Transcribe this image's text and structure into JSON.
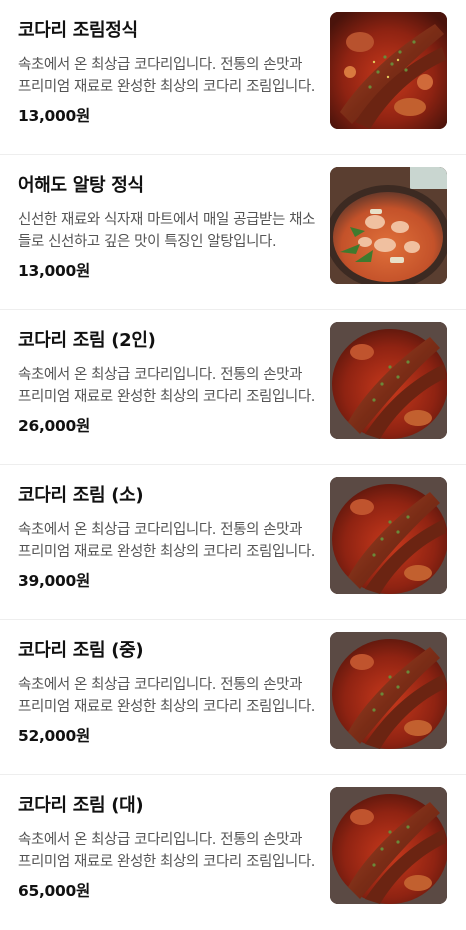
{
  "menu": {
    "items": [
      {
        "name": "코다리 조림정식",
        "description": "속초에서 온 최상급 코다리입니다. 전통의 손맛과 프리미엄 재료로 완성한 최상의 코다리 조림입니다.",
        "price": "13,000원",
        "image": "braised-pollock-photo"
      },
      {
        "name": "어해도 알탕 정식",
        "description": "신선한 재료와 식자재 마트에서 매일 공급받는 채소들로 신선하고 깊은 맛이 특징인 알탕입니다.",
        "price": "13,000원",
        "image": "fish-roe-stew-photo"
      },
      {
        "name": "코다리 조림 (2인)",
        "description": "속초에서 온 최상급 코다리입니다. 전통의 손맛과 프리미엄 재료로 완성한 최상의 코다리 조림입니다.",
        "price": "26,000원",
        "image": "braised-pollock-photo"
      },
      {
        "name": "코다리 조림 (소)",
        "description": "속초에서 온 최상급 코다리입니다. 전통의 손맛과 프리미엄 재료로 완성한 최상의 코다리 조림입니다.",
        "price": "39,000원",
        "image": "braised-pollock-photo"
      },
      {
        "name": "코다리 조림 (중)",
        "description": "속초에서 온 최상급 코다리입니다. 전통의 손맛과 프리미엄 재료로 완성한 최상의 코다리 조림입니다.",
        "price": "52,000원",
        "image": "braised-pollock-photo"
      },
      {
        "name": "코다리 조림 (대)",
        "description": "속초에서 온 최상급 코다리입니다. 전통의 손맛과 프리미엄 재료로 완성한 최상의 코다리 조림입니다.",
        "price": "65,000원",
        "image": "braised-pollock-photo"
      }
    ]
  }
}
